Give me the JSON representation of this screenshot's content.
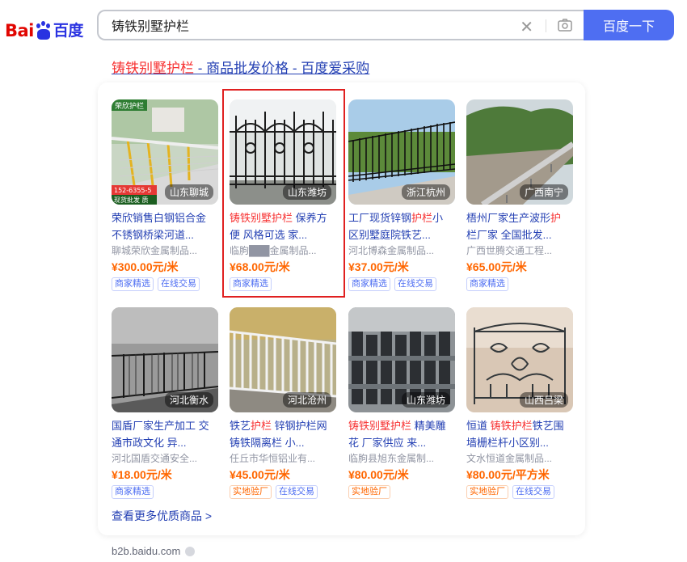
{
  "logo": {
    "part1": "Bai",
    "part2": "百度"
  },
  "search": {
    "query": "铸铁别墅护栏",
    "button": "百度一下"
  },
  "result": {
    "title_em": "铸铁别墅护栏",
    "title_rest": " - 商品批发价格 - 百度爱采购"
  },
  "products": [
    {
      "loc": "山东聊城",
      "n1": "荣欣销售白钢铝合金",
      "n2": "",
      "n3": "",
      "n4": "不锈钢桥梁河道...",
      "shop": "聊城荣欣金属制品...",
      "price": "¥300.00元/米",
      "tags": [
        "商家精选",
        "在线交易"
      ],
      "banner": "荣欣护栏",
      "phone": "152-6355-5",
      "promo": "现货批发 质"
    },
    {
      "loc": "山东潍坊",
      "n1": "",
      "n2": "铸铁别墅护栏",
      "n3": " 保养方",
      "n4": "便 风格可选 家...",
      "shop": "临朐███金属制品...",
      "price": "¥68.00元/米",
      "tags": [
        "商家精选"
      ]
    },
    {
      "loc": "浙江杭州",
      "n1": "工厂现货锌钢",
      "n2": "护栏",
      "n3": "小",
      "n4": "区别墅庭院铁艺...",
      "shop": "河北博森金属制品...",
      "price": "¥37.00元/米",
      "tags": [
        "商家精选",
        "在线交易"
      ]
    },
    {
      "loc": "广西南宁",
      "n1": "梧州厂家生产波形",
      "n2": "护",
      "n3": "",
      "n4": "栏厂家 全国批发...",
      "shop": "广西世腾交通工程...",
      "price": "¥65.00元/米",
      "tags": [
        "商家精选"
      ]
    },
    {
      "loc": "河北衡水",
      "n1": "国盾厂家生产加工 交",
      "n2": "",
      "n3": "",
      "n4": "通市政文化 异...",
      "shop": "河北国盾交通安全...",
      "price": "¥18.00元/米",
      "tags": [
        "商家精选"
      ]
    },
    {
      "loc": "河北沧州",
      "n1": "铁艺",
      "n2": "护栏",
      "n3": " 锌钢护栏网",
      "n4": "铸铁隔离栏 小...",
      "shop": "任丘市华恒铝业有...",
      "price": "¥45.00元/米",
      "tags": [
        "实地验厂",
        "在线交易"
      ]
    },
    {
      "loc": "山东潍坊",
      "n1": "",
      "n2": "铸铁别墅护栏",
      "n3": " 精美雕",
      "n4": "花 厂家供应 来...",
      "shop": "临朐县旭东金属制...",
      "price": "¥80.00元/米",
      "tags": [
        "实地验厂"
      ]
    },
    {
      "loc": "山西吕梁",
      "n1": "恒道 ",
      "n2": "铸铁护栏",
      "n3": "铁艺围",
      "n4": "墙栅栏杆小区别...",
      "shop": "文水恒道金属制品...",
      "price": "¥80.00元/平方米",
      "tags": [
        "实地验厂",
        "在线交易"
      ]
    }
  ],
  "more_link": "查看更多优质商品 >",
  "source": "b2b.baidu.com",
  "colors": {
    "accent": "#4e6ef2",
    "link": "#2440b3",
    "highlight": "#f73131",
    "price": "#ff6600"
  }
}
